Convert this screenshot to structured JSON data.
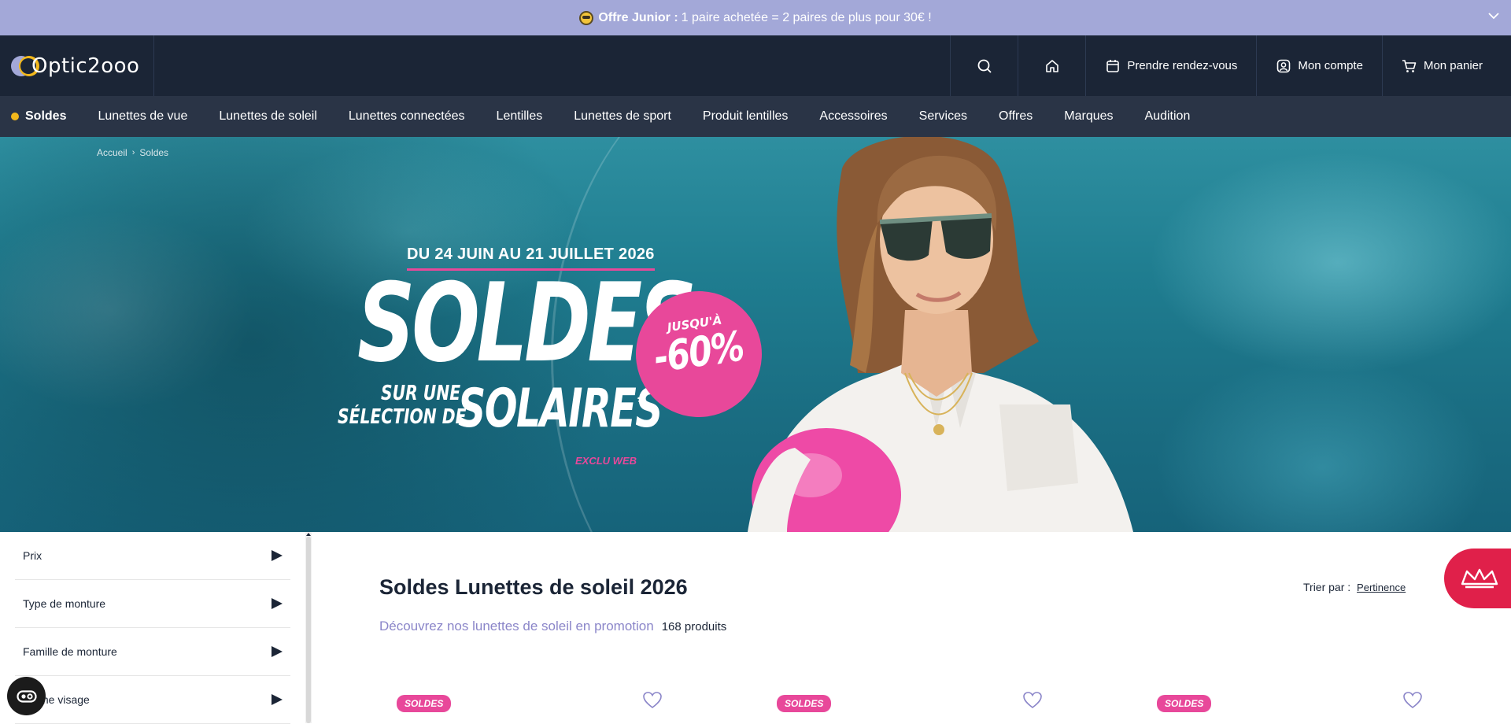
{
  "promo": {
    "bold": "Offre Junior :",
    "text": "1 paire achetée = 2 paires de plus pour 30€ !"
  },
  "header": {
    "logo_text": "Optic2ooo",
    "appointment": "Prendre rendez-vous",
    "account": "Mon compte",
    "cart": "Mon panier"
  },
  "nav": {
    "items": [
      "Soldes",
      "Lunettes de vue",
      "Lunettes de soleil",
      "Lunettes connectées",
      "Lentilles",
      "Lunettes de sport",
      "Produit lentilles",
      "Accessoires",
      "Services",
      "Offres",
      "Marques",
      "Audition"
    ]
  },
  "breadcrumb": [
    "Accueil",
    "Soldes"
  ],
  "hero": {
    "dates": "DU 24 JUIN AU 21 JUILLET 2026",
    "soldes": "SOLDES",
    "sur_une": "SUR UNE",
    "selection_de": "SÉLECTION DE",
    "solaires": "SOLAIRES",
    "asterisk": "*",
    "exclu": "EXCLU WEB",
    "badge_top": "JUSQU'À",
    "badge_pct": "-60%"
  },
  "filters": [
    "Prix",
    "Type de monture",
    "Famille de monture",
    "Forme visage"
  ],
  "main": {
    "title": "Soldes Lunettes de soleil 2026",
    "subtitle": "Découvrez nos lunettes de soleil en promotion",
    "count": "168 produits",
    "sort_label": "Trier par :",
    "sort_value": "Pertinence"
  },
  "cards": [
    {
      "tag": "SOLDES"
    },
    {
      "tag": "SOLDES"
    },
    {
      "tag": "SOLDES"
    }
  ],
  "colors": {
    "promo_bg": "#a3a8d8",
    "header_bg": "#1b2536",
    "nav_bg": "#2a3446",
    "accent_pink": "#e8489a",
    "accent_yellow": "#f2b81c",
    "crown_red": "#e0204a"
  }
}
